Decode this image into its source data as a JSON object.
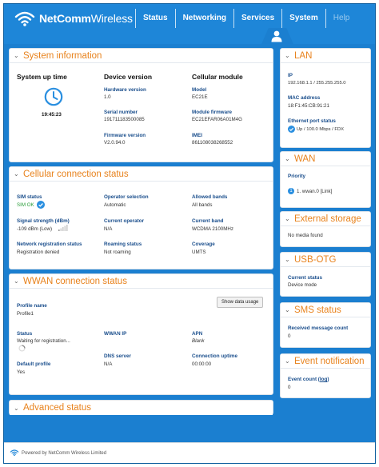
{
  "header": {
    "brand_bold": "NetComm",
    "brand_light": "Wireless",
    "nav": [
      "Status",
      "Networking",
      "Services",
      "System",
      "Help"
    ]
  },
  "system_information": {
    "title": "System information",
    "uptime_title": "System up time",
    "uptime_value": "19:45:23",
    "device_title": "Device version",
    "hardware_version_label": "Hardware version",
    "hardware_version": "1.0",
    "serial_number_label": "Serial number",
    "serial_number": "191711183500085",
    "firmware_version_label": "Firmware version",
    "firmware_version": "V2.0.94.0",
    "cellular_title": "Cellular module",
    "model_label": "Model",
    "model": "EC21E",
    "module_firmware_label": "Module firmware",
    "module_firmware": "EC21EFAR06A01M4G",
    "imei_label": "IMEI",
    "imei": "861108038268552"
  },
  "cellular_status": {
    "title": "Cellular connection status",
    "sim_status_label": "SIM status",
    "sim_status": "SIM OK",
    "operator_selection_label": "Operator selection",
    "operator_selection": "Automatic",
    "allowed_bands_label": "Allowed bands",
    "allowed_bands": "All bands",
    "signal_strength_label": "Signal strength (dBm)",
    "signal_strength": "-109 dBm (Low)",
    "current_operator_label": "Current operator",
    "current_operator": "N/A",
    "current_band_label": "Current band",
    "current_band": "WCDMA 2100MHz",
    "network_registration_label": "Network registration status",
    "network_registration": "Registration denied",
    "roaming_status_label": "Roaming status",
    "roaming_status": "Not roaming",
    "coverage_label": "Coverage",
    "coverage": "UMTS"
  },
  "wwan_status": {
    "title": "WWAN connection status",
    "profile_name_label": "Profile name",
    "profile_name": "Profile1",
    "show_data_usage": "Show data usage",
    "status_label": "Status",
    "status": "Waiting for registration...",
    "wwan_ip_label": "WWAN IP",
    "apn_label": "APN",
    "apn": "Blank",
    "default_profile_label": "Default profile",
    "default_profile": "Yes",
    "dns_server_label": "DNS server",
    "dns_server": "N/A",
    "connection_uptime_label": "Connection uptime",
    "connection_uptime": "00:00:00"
  },
  "advanced_status": {
    "title": "Advanced status"
  },
  "lan": {
    "title": "LAN",
    "ip_label": "IP",
    "ip": "192.168.1.1 / 255.255.255.0",
    "mac_label": "MAC address",
    "mac": "18:F1:45:CB:91:21",
    "ethernet_label": "Ethernet port status",
    "ethernet": "Up / 100.0 Mbps / FDX"
  },
  "wan": {
    "title": "WAN",
    "priority_label": "Priority",
    "priority_num": "1",
    "priority_text": "1. wwan.0 [Link]"
  },
  "external_storage": {
    "title": "External storage",
    "status": "No media found"
  },
  "usb_otg": {
    "title": "USB-OTG",
    "current_status_label": "Current status",
    "current_status": "Device mode"
  },
  "sms_status": {
    "title": "SMS status",
    "received_label": "Received message count",
    "received": "0"
  },
  "event_notification": {
    "title": "Event notification",
    "event_count_label": "Event count",
    "event_count_link": "log",
    "event_count": "0"
  },
  "footer": {
    "text": "Powered by NetComm Wireless Limited"
  },
  "colors": {
    "brand_blue": "#1e86d8",
    "accent_orange": "#e8821c",
    "label_blue": "#1a4e8c",
    "status_green": "#2a9d3a"
  }
}
